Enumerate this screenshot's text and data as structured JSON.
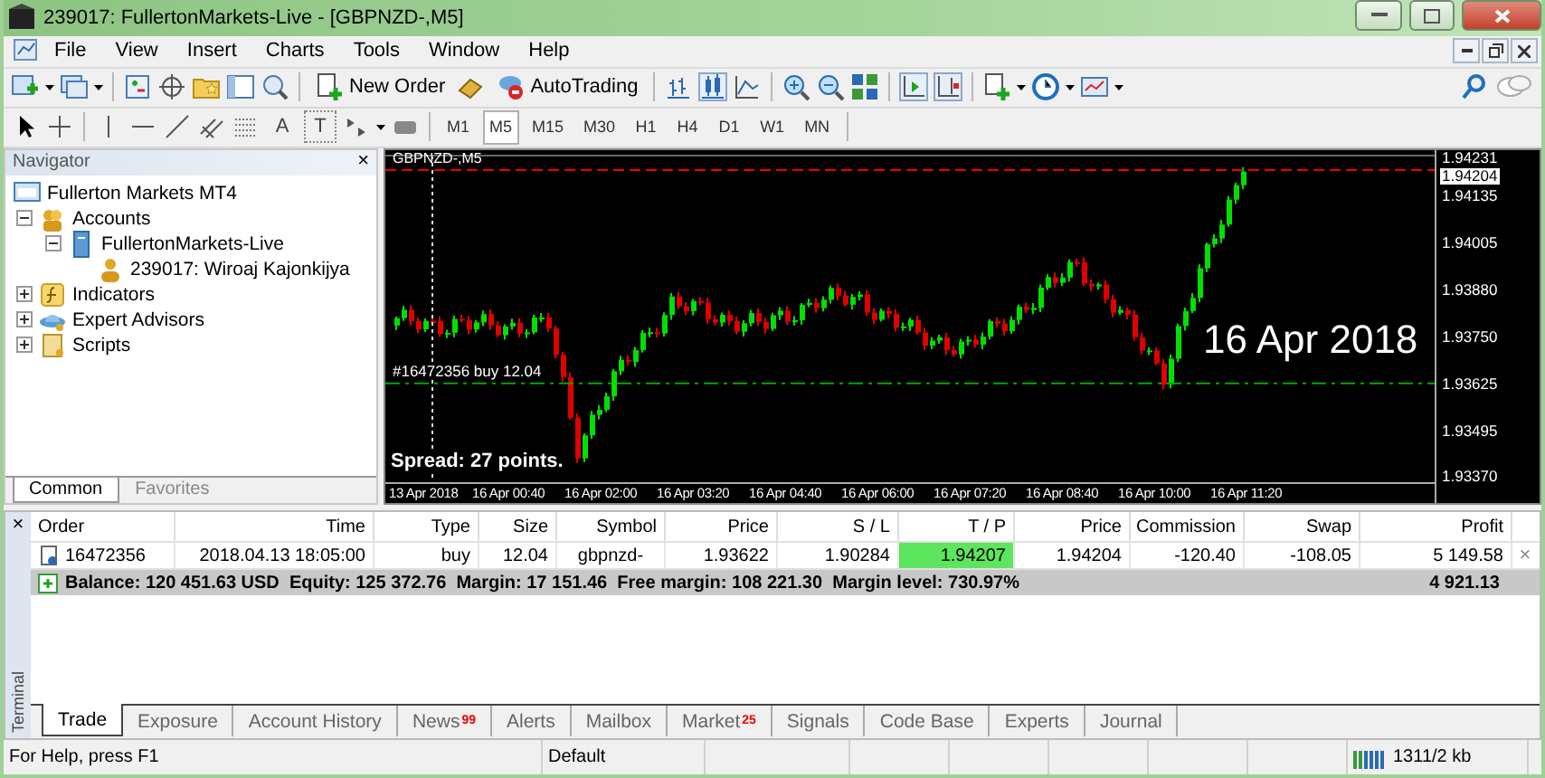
{
  "window": {
    "title": "239017: FullertonMarkets-Live - [GBPNZD-,M5]"
  },
  "menu": [
    "File",
    "View",
    "Insert",
    "Charts",
    "Tools",
    "Window",
    "Help"
  ],
  "toolbar": {
    "new_order": "New Order",
    "auto_trading": "AutoTrading"
  },
  "draw_tools": [
    {
      "kind": "text-label",
      "glyph": "A"
    },
    {
      "kind": "text-box",
      "glyph": "T"
    }
  ],
  "timeframes": [
    {
      "label": "M1",
      "selected": false
    },
    {
      "label": "M5",
      "selected": true
    },
    {
      "label": "M15",
      "selected": false
    },
    {
      "label": "M30",
      "selected": false
    },
    {
      "label": "H1",
      "selected": false
    },
    {
      "label": "H4",
      "selected": false
    },
    {
      "label": "D1",
      "selected": false
    },
    {
      "label": "W1",
      "selected": false
    },
    {
      "label": "MN",
      "selected": false
    }
  ],
  "navigator": {
    "title": "Navigator",
    "close": "×",
    "tree": [
      {
        "label": "Fullerton Markets MT4",
        "kind": "terminal",
        "children": [
          {
            "label": "Accounts",
            "kind": "accounts",
            "expanded": true,
            "children": [
              {
                "label": "FullertonMarkets-Live",
                "kind": "server",
                "expanded": true,
                "children": [
                  {
                    "label": "239017: Wiroaj Kajonkijya",
                    "kind": "user"
                  }
                ]
              }
            ]
          },
          {
            "label": "Indicators",
            "kind": "indicators",
            "expanded": false
          },
          {
            "label": "Expert Advisors",
            "kind": "experts",
            "expanded": false
          },
          {
            "label": "Scripts",
            "kind": "scripts",
            "expanded": false
          }
        ]
      }
    ],
    "tabs": [
      {
        "label": "Common",
        "selected": true
      },
      {
        "label": "Favorites",
        "selected": false
      }
    ]
  },
  "chart": {
    "symbol_label": "GBPNZD-,M5",
    "order_label": "#16472356 buy 12.04",
    "date_overlay": "16 Apr 2018",
    "spread": "Spread: 27 points.",
    "price_labels": [
      {
        "label": "1.94231",
        "current": false
      },
      {
        "label": "1.94204",
        "current": true
      },
      {
        "label": "1.94135",
        "current": false
      },
      {
        "label": "1.94005",
        "current": false
      },
      {
        "label": "1.93880",
        "current": false
      },
      {
        "label": "1.93750",
        "current": false
      },
      {
        "label": "1.93625",
        "current": false
      },
      {
        "label": "1.93495",
        "current": false
      },
      {
        "label": "1.93370",
        "current": false
      }
    ],
    "time_labels": [
      "13 Apr 2018",
      "16 Apr 00:40",
      "16 Apr 02:00",
      "16 Apr 03:20",
      "16 Apr 04:40",
      "16 Apr 06:00",
      "16 Apr 07:20",
      "16 Apr 08:40",
      "16 Apr 10:00",
      "16 Apr 11:20"
    ]
  },
  "terminal": {
    "side_label": "Terminal",
    "close": "×",
    "columns": [
      "Order",
      "Time",
      "Type",
      "Size",
      "Symbol",
      "Price",
      "S / L",
      "T / P",
      "Price",
      "Commission",
      "Swap",
      "Profit"
    ],
    "rows": [
      {
        "cells": [
          "16472356",
          "2018.04.13 18:05:00",
          "buy",
          "12.04",
          "gbpnzd-",
          "1.93622",
          "1.90284",
          "1.94207",
          "1.94204",
          "-120.40",
          "-108.05",
          "5 149.58"
        ],
        "tp_highlight": true,
        "close": "×"
      }
    ],
    "summary": "Balance: 120 451.63 USD  Equity: 125 372.76  Margin: 17 151.46  Free margin: 108 221.30  Margin level: 730.97%",
    "summary_profit": "4 921.13",
    "tabs": [
      {
        "label": "Trade",
        "selected": true
      },
      {
        "label": "Exposure",
        "selected": false
      },
      {
        "label": "Account History",
        "selected": false
      },
      {
        "label": "News",
        "badge": "99",
        "selected": false
      },
      {
        "label": "Alerts",
        "selected": false
      },
      {
        "label": "Mailbox",
        "selected": false
      },
      {
        "label": "Market",
        "badge": "25",
        "selected": false
      },
      {
        "label": "Signals",
        "selected": false
      },
      {
        "label": "Code Base",
        "selected": false
      },
      {
        "label": "Experts",
        "selected": false
      },
      {
        "label": "Journal",
        "selected": false
      }
    ]
  },
  "status_bar": {
    "help": "For Help, press F1",
    "profile": "Default",
    "traffic": "1311/2 kb"
  }
}
